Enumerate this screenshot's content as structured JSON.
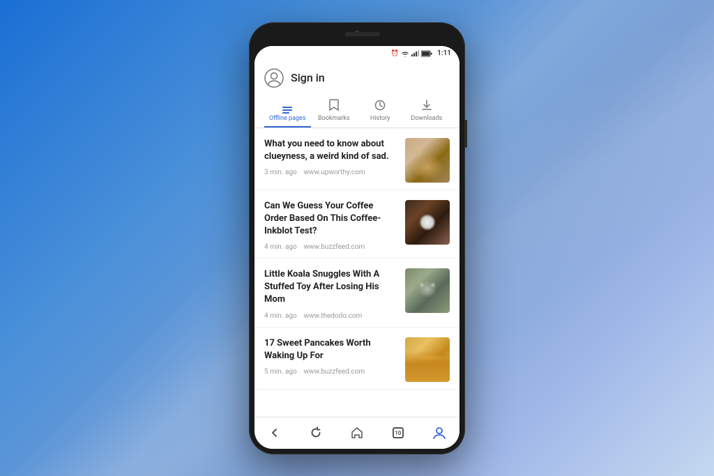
{
  "background": {
    "gradient_start": "#1a6fd4",
    "gradient_end": "#c5d8f0"
  },
  "status_bar": {
    "time": "1:11",
    "icons": [
      "alarm",
      "wifi",
      "signal",
      "battery"
    ]
  },
  "header": {
    "sign_in_label": "Sign in"
  },
  "tabs": [
    {
      "id": "offline",
      "label": "Offline pages",
      "active": true
    },
    {
      "id": "bookmarks",
      "label": "Bookmarks",
      "active": false
    },
    {
      "id": "history",
      "label": "History",
      "active": false
    },
    {
      "id": "downloads",
      "label": "Downloads",
      "active": false
    }
  ],
  "articles": [
    {
      "title": "What you need to know about clueyness, a weird kind of sad.",
      "time_ago": "3 min. ago",
      "source": "www.upworthy.com",
      "thumb_type": "dog"
    },
    {
      "title": "Can We Guess Your Coffee Order Based On This Coffee-Inkblot Test?",
      "time_ago": "4 min. ago",
      "source": "www.buzzfeed.com",
      "thumb_type": "coffee"
    },
    {
      "title": "Little Koala Snuggles With A Stuffed Toy After Losing His Mom",
      "time_ago": "4 min. ago",
      "source": "www.thedodo.com",
      "thumb_type": "koala"
    },
    {
      "title": "17 Sweet Pancakes Worth Waking Up For",
      "time_ago": "5 min. ago",
      "source": "www.buzzfeed.com",
      "thumb_type": "pancakes"
    }
  ],
  "bottom_nav": {
    "back_label": "back",
    "refresh_label": "refresh",
    "home_label": "home",
    "tabs_count": "10",
    "account_label": "account"
  }
}
